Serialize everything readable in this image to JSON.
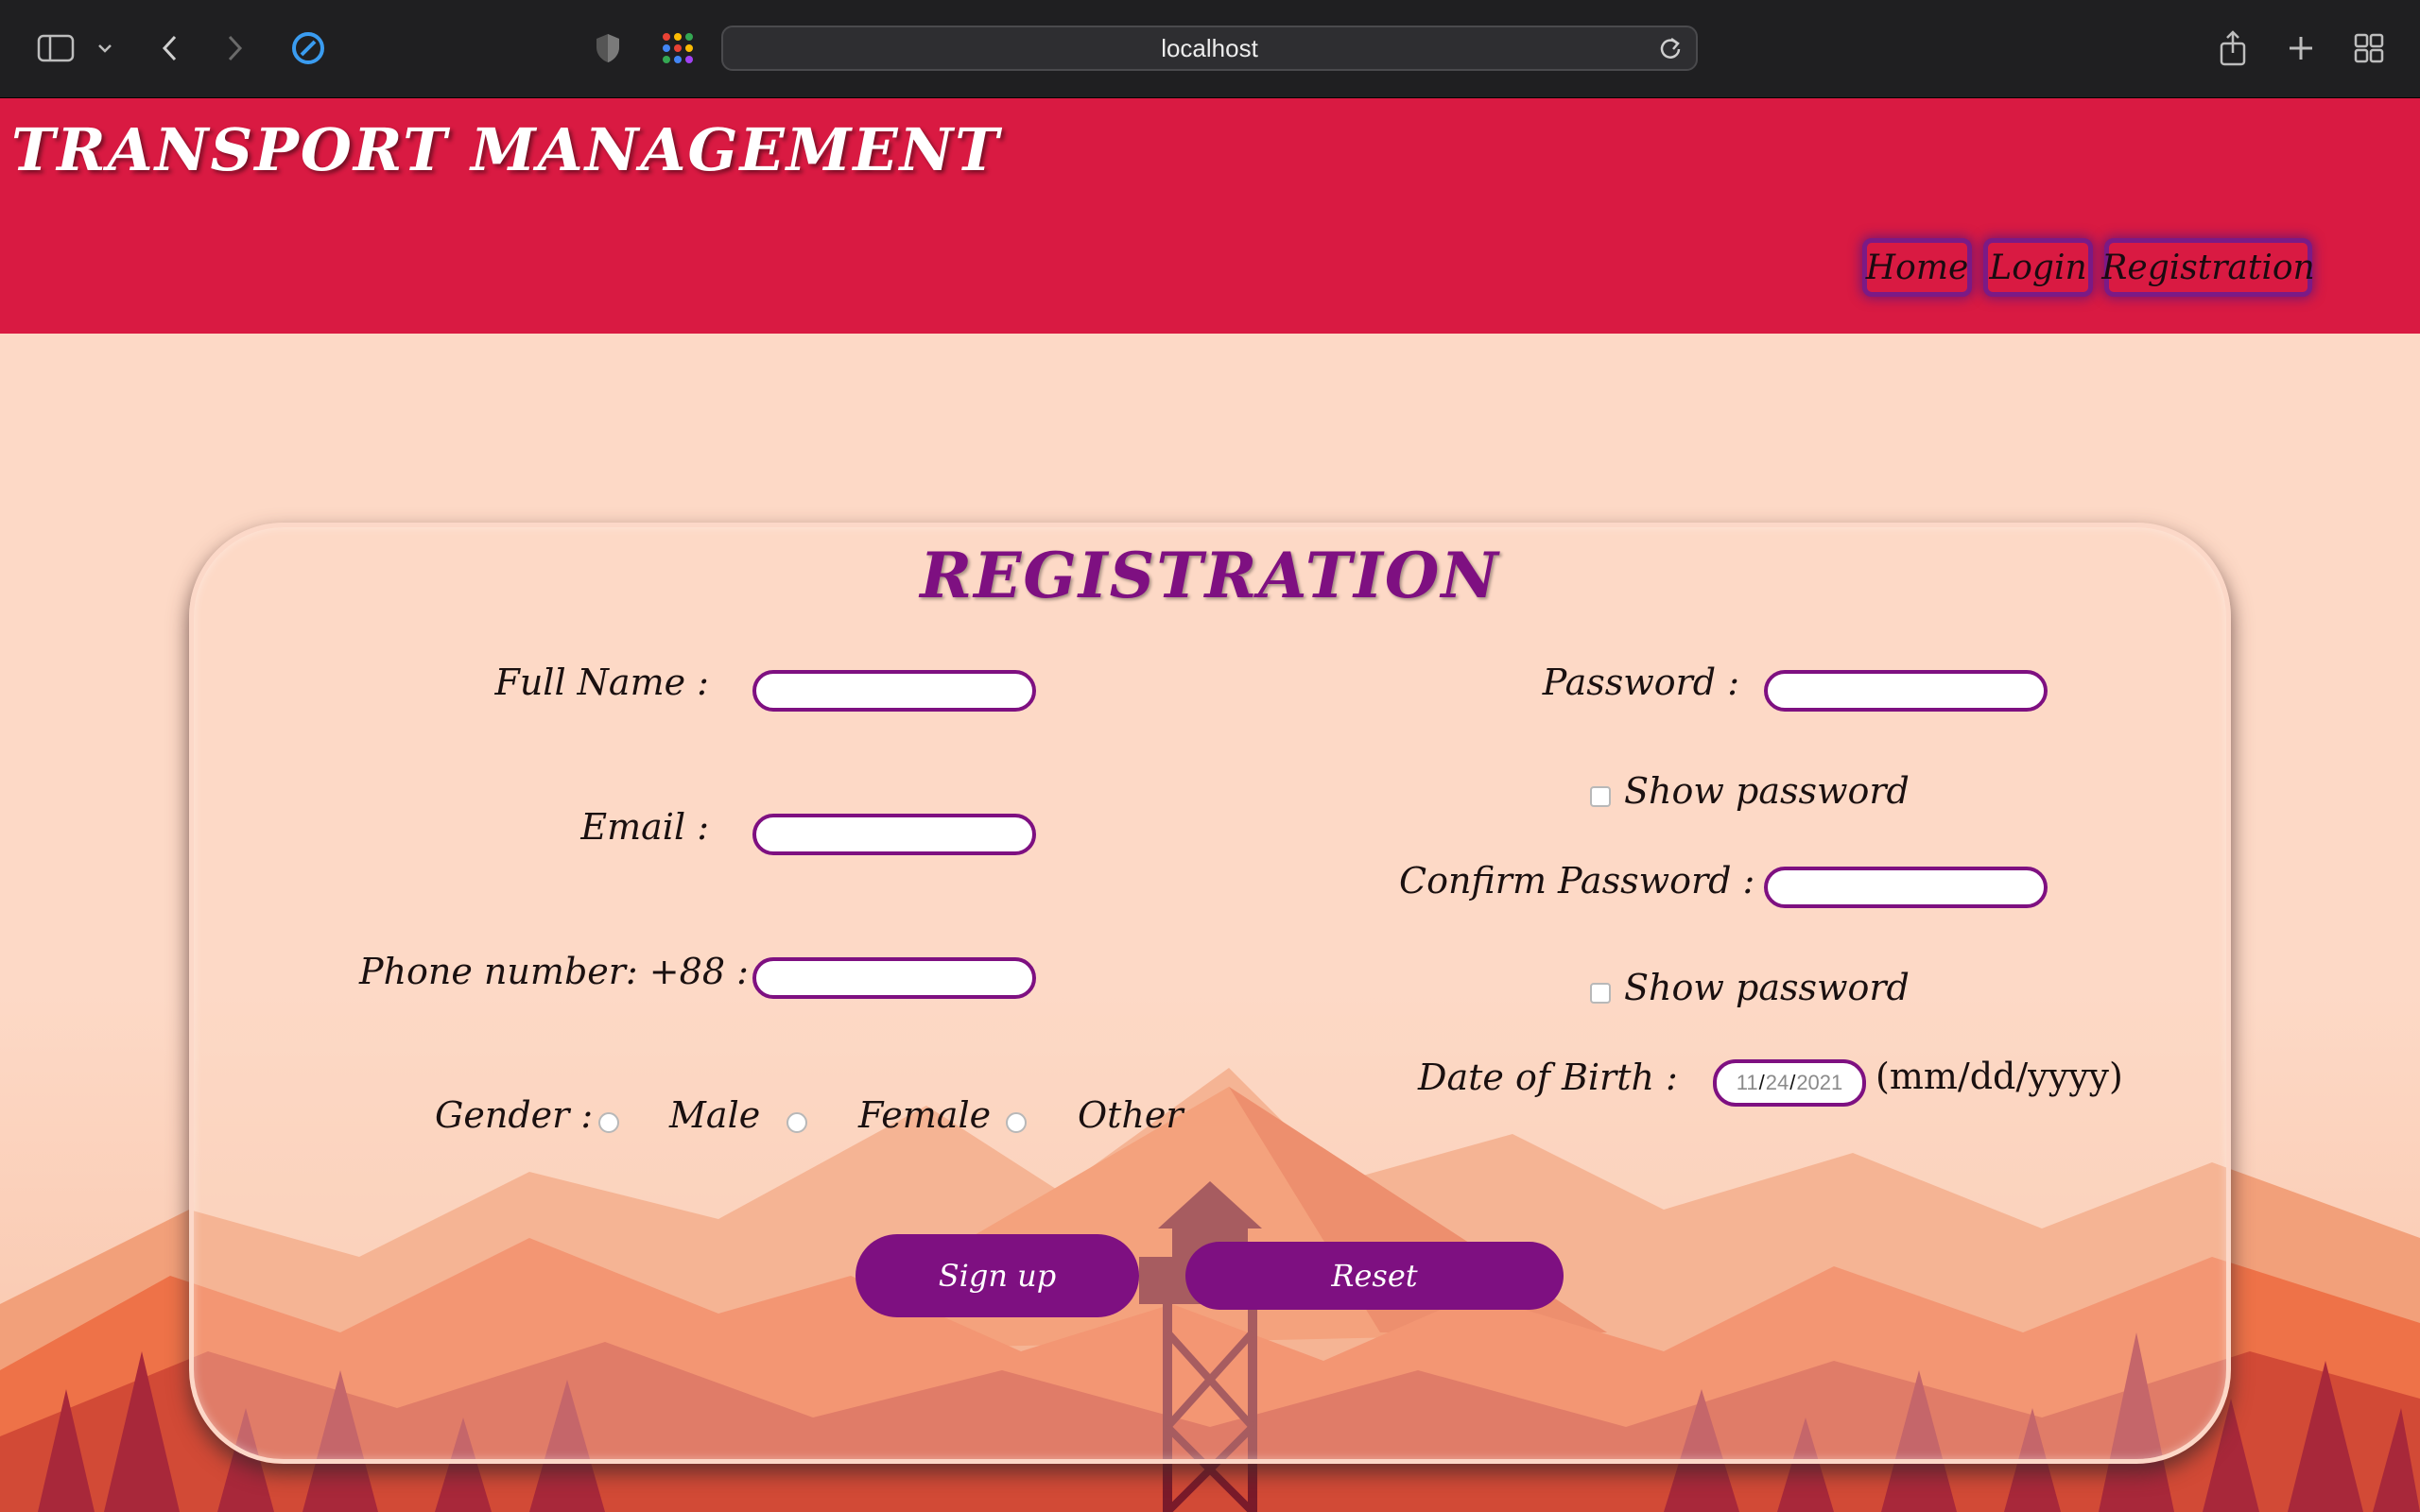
{
  "browser": {
    "url": "localhost"
  },
  "header": {
    "title": "TRANSPORT MANAGEMENT",
    "nav": [
      "Home",
      "Login",
      "Registration"
    ]
  },
  "form": {
    "title": "REGISTRATION",
    "full_name_label": "Full Name :",
    "email_label": "Email :",
    "phone_label": "Phone number: +88 :",
    "gender_label": "Gender :",
    "gender_options": [
      "Male",
      "Female",
      "Other"
    ],
    "password_label": "Password :",
    "show_password_label": "Show password",
    "confirm_password_label": "Confirm Password :",
    "dob_label": "Date of Birth :",
    "dob_value": {
      "mm": "11",
      "dd": "24",
      "yyyy": "2021"
    },
    "dob_format_hint": "(mm/dd/yyyy)",
    "signup_label": "Sign up",
    "reset_label": "Reset"
  },
  "colors": {
    "header_bg": "#d91a42",
    "accent": "#7e1081",
    "page_bg": "#fdd9c6"
  }
}
